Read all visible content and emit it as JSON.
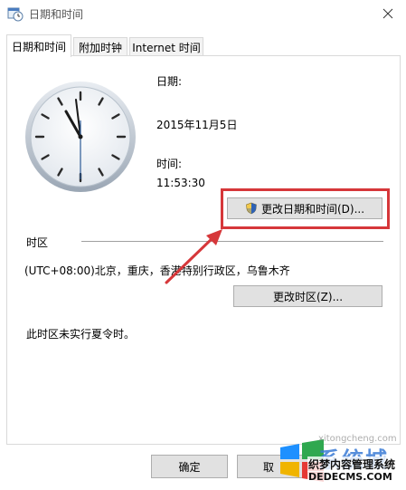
{
  "window": {
    "title": "日期和时间"
  },
  "tabs": [
    {
      "label": "日期和时间"
    },
    {
      "label": "附加时钟"
    },
    {
      "label": "Internet 时间"
    }
  ],
  "datetime": {
    "date_label": "日期:",
    "date_value": "2015年11月5日",
    "time_label": "时间:",
    "time_value": "11:53:30",
    "change_datetime_button": "更改日期和时间(D)..."
  },
  "timezone": {
    "section_label": "时区",
    "value": "(UTC+08:00)北京，重庆，香港特别行政区，乌鲁木齐",
    "change_timezone_button": "更改时区(Z)...",
    "dst_note": "此时区未实行夏令时。"
  },
  "buttons": {
    "ok": "确定",
    "cancel": "取"
  },
  "watermark": {
    "brand": "系统城",
    "site": "xitongcheng.com",
    "overlay_title": "织梦内容管理系统",
    "overlay_site": "DEDECMS.COM"
  },
  "colors": {
    "highlight": "#d6373a",
    "accent": "#0078d7"
  },
  "icons": {
    "app": "calendar-clock-icon",
    "close": "close-icon",
    "shield": "uac-shield-icon"
  }
}
